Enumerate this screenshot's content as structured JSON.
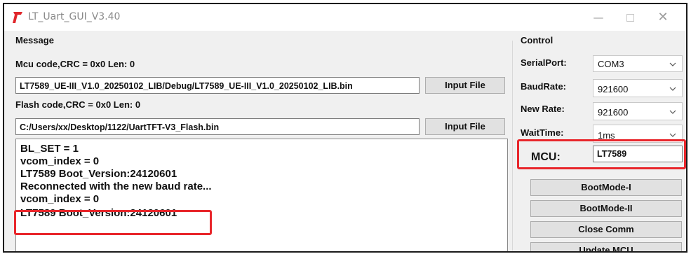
{
  "window": {
    "title": "LT_Uart_GUI_V3.40",
    "minimize_glyph": "—",
    "close_glyph": "✕",
    "accent_icon_color": "#e0262b"
  },
  "message": {
    "group_label": "Message",
    "mcu_code_label": "Mcu code,CRC = 0x0  Len: 0",
    "mcu_file_path": "LT7589_UE-III_V1.0_20250102_LIB/Debug/LT7589_UE-III_V1.0_20250102_LIB.bin",
    "mcu_input_button": "Input File",
    "flash_code_label": "Flash code,CRC = 0x0  Len: 0",
    "flash_file_path": "C:/Users/xx/Desktop/1122/UartTFT-V3_Flash.bin",
    "flash_input_button": "Input File"
  },
  "log": {
    "lines": [
      "BL_SET = 1",
      "vcom_index = 0",
      "LT7589 Boot_Version:24120601",
      "Reconnected with the new baud rate...",
      "vcom_index = 0",
      "LT7589 Boot_Version:24120601"
    ]
  },
  "control": {
    "group_label": "Control",
    "serial_port_label": "SerialPort:",
    "serial_port_value": "COM3",
    "baud_rate_label": "BaudRate:",
    "baud_rate_value": "921600",
    "new_rate_label": "New Rate:",
    "new_rate_value": "921600",
    "wait_time_label": "WaitTime:",
    "wait_time_value": "1ms",
    "mcu_label": "MCU:",
    "mcu_value": "LT7589",
    "buttons": [
      "BootMode-I",
      "BootMode-II",
      "Close Comm",
      "Update MCU"
    ]
  },
  "highlight_color": "#e8262b"
}
